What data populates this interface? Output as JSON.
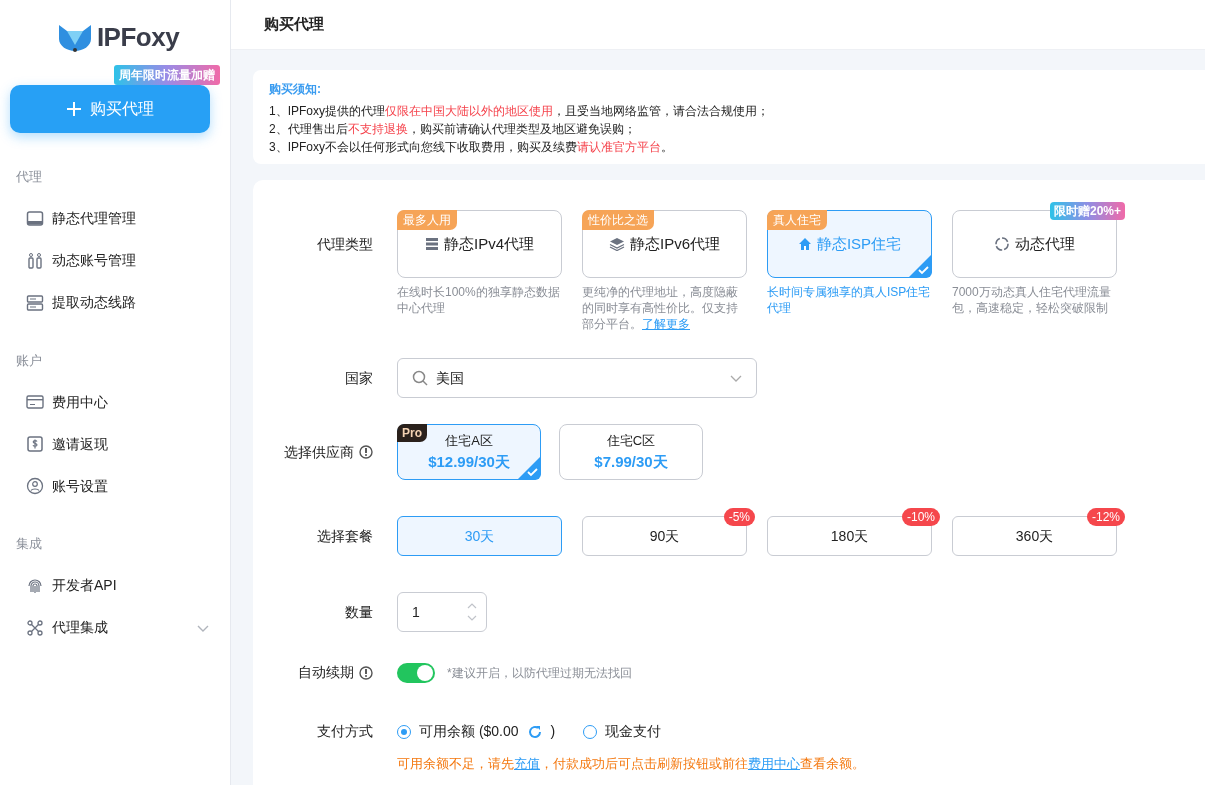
{
  "logo": {
    "text": "IPFoxy"
  },
  "promo_badge": "周年限时流量加赠",
  "buy_button": {
    "label": "购买代理"
  },
  "sidebar": {
    "sections": [
      {
        "title": "代理",
        "items": [
          {
            "label": "静态代理管理"
          },
          {
            "label": "动态账号管理"
          },
          {
            "label": "提取动态线路"
          }
        ]
      },
      {
        "title": "账户",
        "items": [
          {
            "label": "费用中心"
          },
          {
            "label": "邀请返现"
          },
          {
            "label": "账号设置"
          }
        ]
      },
      {
        "title": "集成",
        "items": [
          {
            "label": "开发者API"
          },
          {
            "label": "代理集成",
            "expanded": false
          }
        ]
      }
    ]
  },
  "page_title": "购买代理",
  "notice": {
    "title": "购买须知:",
    "lines": [
      [
        {
          "text": "1、IPFoxy提供的代理",
          "highlight": false
        },
        {
          "text": "仅限在中国大陆以外的地区使用",
          "highlight": true
        },
        {
          "text": "，且受当地网络监管，请合法合规使用；",
          "highlight": false
        }
      ],
      [
        {
          "text": "2、代理售出后",
          "highlight": false
        },
        {
          "text": "不支持退换",
          "highlight": true
        },
        {
          "text": "，购买前请确认代理类型及地区避免误购；",
          "highlight": false
        }
      ],
      [
        {
          "text": "3、IPFoxy不会以任何形式向您线下收取费用，购买及续费",
          "highlight": false
        },
        {
          "text": "请认准官方平台",
          "highlight": true
        },
        {
          "text": "。",
          "highlight": false
        }
      ]
    ]
  },
  "proxy_type": {
    "label": "代理类型",
    "options": [
      {
        "tag": "最多人用",
        "name": "静态IPv4代理",
        "description": "在线时长100%的独享静态数据中心代理",
        "selected": false
      },
      {
        "tag": "性价比之选",
        "name": "静态IPv6代理",
        "description": "更纯净的代理地址，高度隐蔽的同时享有高性价比。仅支持部分平台。",
        "link": "了解更多",
        "selected": false
      },
      {
        "tag": "真人住宅",
        "name": "静态ISP住宅",
        "description": "长时间专属独享的真人ISP住宅代理",
        "selected": true
      },
      {
        "promo": "限时赠20%+",
        "name": "动态代理",
        "description": "7000万动态真人住宅代理流量包，高速稳定，轻松突破限制",
        "selected": false
      }
    ]
  },
  "country": {
    "label": "国家",
    "value": "美国"
  },
  "provider": {
    "label": "选择供应商",
    "options": [
      {
        "tag": "Pro",
        "name": "住宅A区",
        "price": "$12.99/30天",
        "selected": true
      },
      {
        "name": "住宅C区",
        "price": "$7.99/30天",
        "selected": false
      }
    ]
  },
  "plan": {
    "label": "选择套餐",
    "options": [
      {
        "label": "30天",
        "selected": true
      },
      {
        "label": "90天",
        "discount": "-5%",
        "selected": false
      },
      {
        "label": "180天",
        "discount": "-10%",
        "selected": false
      },
      {
        "label": "360天",
        "discount": "-12%",
        "selected": false
      }
    ]
  },
  "quantity": {
    "label": "数量",
    "value": "1"
  },
  "auto_renew": {
    "label": "自动续期",
    "on": true,
    "hint": "*建议开启，以防代理过期无法找回"
  },
  "payment": {
    "label": "支付方式",
    "options": [
      {
        "label": "可用余额 ($0.00",
        "label_after": ")",
        "selected": true
      },
      {
        "label": "现金支付",
        "selected": false
      }
    ],
    "warning": [
      {
        "text": "可用余额不足，请先",
        "link": false
      },
      {
        "text": "充值",
        "link": true
      },
      {
        "text": "，付款成功后可点击刷新按钮或前往",
        "link": false
      },
      {
        "text": "费用中心",
        "link": true
      },
      {
        "text": "查看余额。",
        "link": false
      }
    ]
  }
}
